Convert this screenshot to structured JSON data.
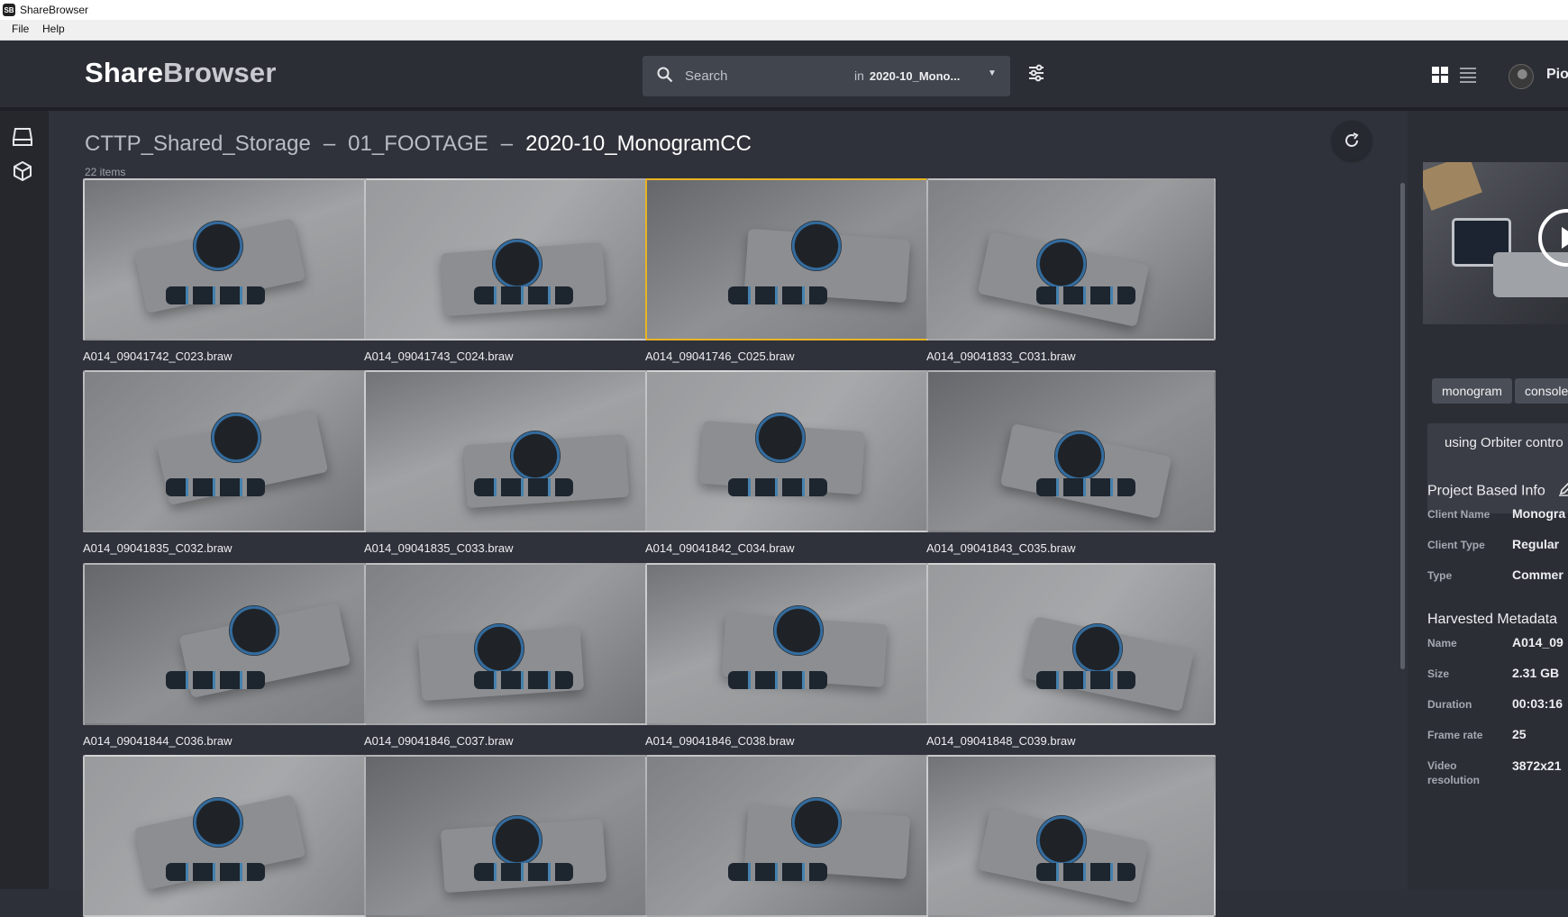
{
  "window": {
    "title": "ShareBrowser",
    "icon_text": "SB"
  },
  "menu": [
    "File",
    "Help"
  ],
  "header": {
    "logo_part1": "Share",
    "logo_part2": "Browser",
    "search_placeholder": "Search",
    "search_in": "in",
    "search_scope": "2020-10_Mono...",
    "user": "Piot"
  },
  "breadcrumb": [
    "CTTP_Shared_Storage",
    "01_FOOTAGE",
    "2020-10_MonogramCC"
  ],
  "breadcrumb_sep": "–",
  "item_count": "22 items",
  "files": [
    "A014_09041742_C023.braw",
    "A014_09041743_C024.braw",
    "A014_09041746_C025.braw",
    "A014_09041833_C031.braw",
    "A014_09041835_C032.braw",
    "A014_09041835_C033.braw",
    "A014_09041842_C034.braw",
    "A014_09041843_C035.braw",
    "A014_09041844_C036.braw",
    "A014_09041846_C037.braw",
    "A014_09041846_C038.braw",
    "A014_09041848_C039.braw"
  ],
  "selected_index": 2,
  "details": {
    "tags": [
      "monogram",
      "console"
    ],
    "description": "using Orbiter contro",
    "project_title": "Project Based Info",
    "project_fields": [
      {
        "label": "Client Name",
        "value": "Monogra"
      },
      {
        "label": "Client Type",
        "value": "Regular"
      },
      {
        "label": "Type",
        "value": "Commer"
      }
    ],
    "harvested_title": "Harvested Metadata",
    "harvested_fields": [
      {
        "label": "Name",
        "value": "A014_09"
      },
      {
        "label": "Size",
        "value": "2.31 GB"
      },
      {
        "label": "Duration",
        "value": "00:03:16"
      },
      {
        "label": "Frame rate",
        "value": "25"
      },
      {
        "label": "Video resolution",
        "value": "3872x21"
      }
    ]
  },
  "colors": {
    "accent_selected": "#e9b424",
    "background": "#2f323a",
    "header": "#2b2e35"
  }
}
